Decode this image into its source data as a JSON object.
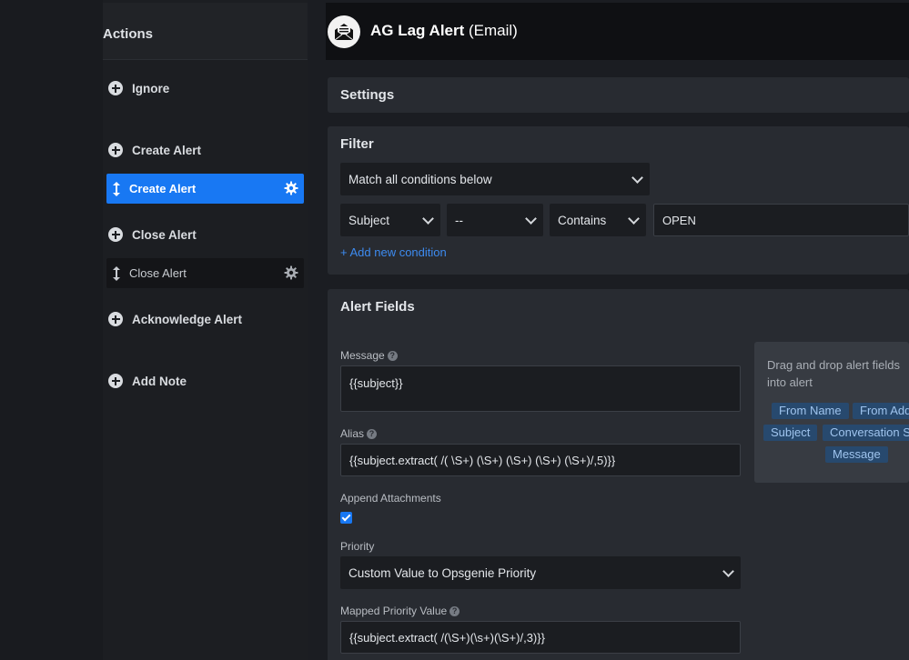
{
  "sidebar": {
    "title": "Actions",
    "actions": [
      {
        "label": "Ignore"
      },
      {
        "label": "Create Alert"
      },
      {
        "label": "Close Alert"
      },
      {
        "label": "Acknowledge Alert"
      },
      {
        "label": "Add Note"
      }
    ],
    "rules": [
      {
        "label": "Create Alert",
        "active": true
      },
      {
        "label": "Close Alert",
        "active": false
      }
    ]
  },
  "header": {
    "title": "AG Lag Alert",
    "subtitle": "(Email)",
    "logo_icon": "email-envelope-icon"
  },
  "settings": {
    "title": "Settings"
  },
  "filter": {
    "title": "Filter",
    "match_mode": "Match all conditions below",
    "condition": {
      "field": "Subject",
      "subfield": "--",
      "operator": "Contains",
      "value": "OPEN"
    },
    "add_condition_label": "+ Add new condition"
  },
  "alert_fields": {
    "title": "Alert Fields",
    "message_label": "Message",
    "message_value": "{{subject}}",
    "alias_label": "Alias",
    "alias_value": "{{subject.extract( /( \\S+) (\\S+) (\\S+) (\\S+) (\\S+)/,5)}}",
    "append_attachments_label": "Append Attachments",
    "append_attachments_checked": true,
    "priority_label": "Priority",
    "priority_value": "Custom Value to Opsgenie Priority",
    "mapped_priority_label": "Mapped Priority Value",
    "mapped_priority_value": "{{subject.extract( /(\\S+)(\\s+)(\\S+)/,3)}}"
  },
  "dnd": {
    "hint": "Drag and drop alert fields into alert",
    "chips": [
      "From Name",
      "From Address",
      "Subject",
      "Conversation Subject",
      "Message"
    ]
  },
  "colors": {
    "accent": "#1878f3",
    "panel": "#282b31",
    "header": "#0f1013"
  }
}
